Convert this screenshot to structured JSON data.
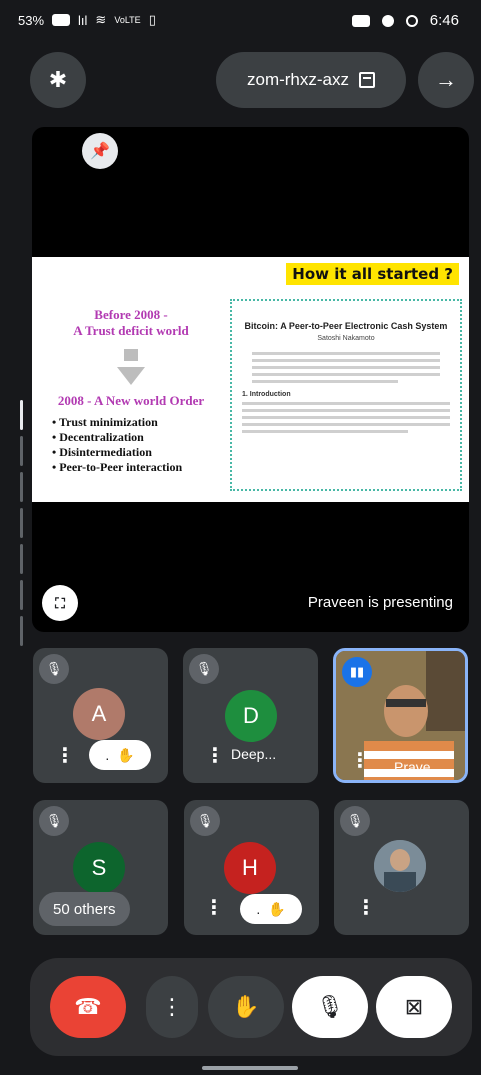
{
  "status_bar": {
    "time": "6:46",
    "battery": "53%",
    "signal_text": "lıl",
    "network_text": "VoLTE"
  },
  "top_bar": {
    "meeting_code": "zom-rhxz-axz",
    "bluetooth_icon": "bluetooth-icon",
    "forward_icon": "arrow-right-icon"
  },
  "presentation": {
    "presenter_text": "Praveen is presenting",
    "slide": {
      "title": "How it all started ?",
      "before_text_line1": "Before 2008 -",
      "before_text_line2": "A Trust deficit world",
      "after_text": "2008 - A New world Order",
      "bullets": [
        "Trust minimization",
        "Decentralization",
        "Disintermediation",
        "Peer-to-Peer interaction"
      ],
      "paper_title": "Bitcoin: A Peer-to-Peer Electronic Cash System",
      "paper_author": "Satoshi Nakamoto",
      "paper_section": "1. Introduction"
    }
  },
  "participants": [
    {
      "name": "Prave...",
      "type": "video",
      "speaking": true
    },
    {
      "name": "Deep...",
      "initial": "D",
      "avatar_color": "#1e8e3e",
      "muted": true
    },
    {
      "name": "",
      "initial": "A",
      "avatar_color": "#b07a6a",
      "muted": true,
      "hand_raised": true
    },
    {
      "name": "",
      "type": "photo",
      "muted": true
    },
    {
      "name": "",
      "initial": "H",
      "avatar_color": "#c5221f",
      "muted": true,
      "hand_raised": true
    },
    {
      "name": "",
      "initial": "S",
      "avatar_color": "#0d652d",
      "muted": true,
      "others_label": "50 others"
    }
  ],
  "hand_pill_text": ".",
  "controls": {
    "end_call_icon": "phone-hangup-icon",
    "more_icon": "more-vert-icon",
    "raise_hand_icon": "hand-icon",
    "mic_icon": "mic-off-icon",
    "camera_icon": "camera-off-icon"
  },
  "colors": {
    "end_call": "#ea4335",
    "tile_bg": "#3c4043",
    "speaking_border": "#8ab4f8"
  }
}
